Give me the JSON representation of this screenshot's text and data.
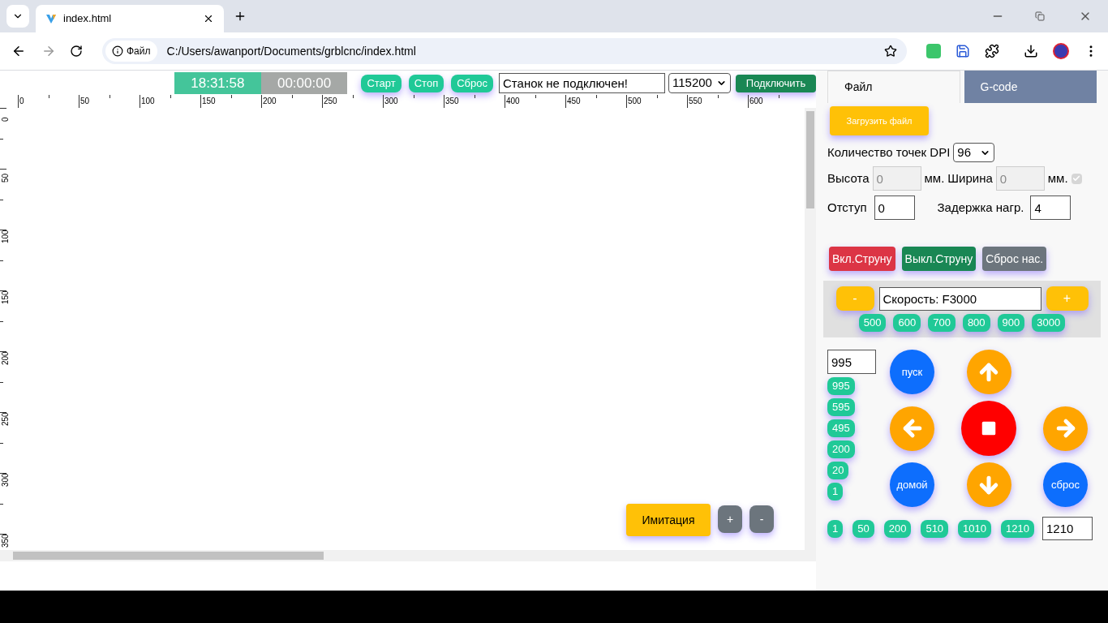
{
  "browser": {
    "tab_title": "index.html",
    "site_chip": "Файл",
    "url": "C:/Users/awanport/Documents/grblcnc/index.html"
  },
  "topbar": {
    "clock": "18:31:58",
    "timer": "00:00:00",
    "buttons": [
      "Старт",
      "Стоп",
      "Сброс"
    ],
    "status": "Станок не подключен!",
    "baud": "115200",
    "connect": "Подключить"
  },
  "ruler": {
    "x_labels": [
      "0",
      "50",
      "100",
      "150",
      "200",
      "250",
      "300",
      "350",
      "400",
      "450",
      "500",
      "550",
      "600"
    ],
    "y_labels": [
      "0",
      "50",
      "100",
      "150",
      "200",
      "250",
      "300",
      "350"
    ]
  },
  "canvas_buttons": {
    "simulate": "Имитация",
    "zoom": [
      "+",
      "-"
    ]
  },
  "panel": {
    "tabs": [
      {
        "label": "Файл",
        "selected": true
      },
      {
        "label": "G-code",
        "selected": false
      }
    ],
    "load_button": "Загрузить файл",
    "dpi": {
      "label": "Количество точек DPI",
      "value": "96"
    },
    "height": {
      "label": "Высота",
      "value": "0",
      "unit": "мм."
    },
    "width": {
      "label": "Ширина",
      "value": "0",
      "unit": "мм."
    },
    "size_checkbox": {
      "checked": true,
      "disabled": true
    },
    "offset": {
      "label": "Отступ",
      "value": "0"
    },
    "delay": {
      "label": "Задержка нагр.",
      "value": "4"
    },
    "string_buttons": [
      {
        "label": "Вкл.Струну",
        "kind": "danger"
      },
      {
        "label": "Выкл.Струну",
        "kind": "success"
      },
      {
        "label": "Сброс нас.",
        "kind": "secondary"
      }
    ],
    "speed": {
      "minus": "-",
      "value": "Скорость: F3000",
      "plus": "+",
      "presets": [
        "500",
        "600",
        "700",
        "800",
        "900",
        "3000"
      ]
    },
    "jog": {
      "step_value": "995",
      "step_presets": [
        "995",
        "595",
        "495",
        "200",
        "20",
        "1"
      ],
      "buttons": [
        {
          "kind": "start",
          "label": "пуск"
        },
        {
          "kind": "up"
        },
        {
          "kind": "left"
        },
        {
          "kind": "stop"
        },
        {
          "kind": "right"
        },
        {
          "kind": "home",
          "label": "домой"
        },
        {
          "kind": "down"
        },
        {
          "kind": "reset",
          "label": "сброс"
        }
      ],
      "feed_presets": [
        "1",
        "50",
        "200",
        "510",
        "1010",
        "1210"
      ],
      "feed_value": "1210"
    }
  }
}
